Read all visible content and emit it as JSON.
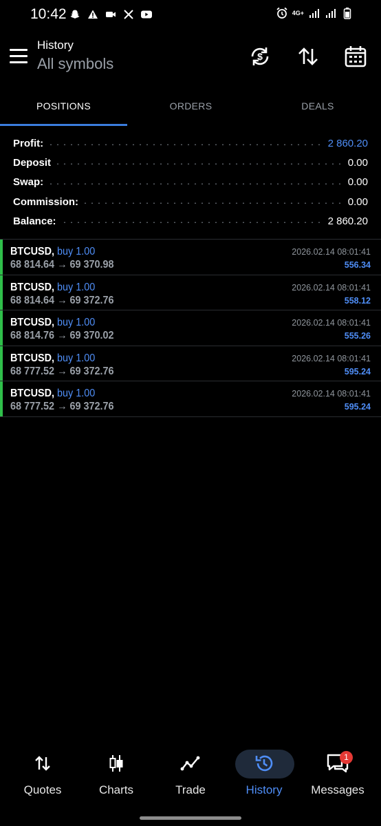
{
  "status_bar": {
    "time": "10:42",
    "network": "4G+"
  },
  "header": {
    "title": "History",
    "subtitle": "All symbols"
  },
  "tabs": [
    {
      "label": "POSITIONS",
      "active": true
    },
    {
      "label": "ORDERS",
      "active": false
    },
    {
      "label": "DEALS",
      "active": false
    }
  ],
  "summary": [
    {
      "label": "Profit:",
      "value": "2 860.20"
    },
    {
      "label": "Deposit",
      "value": "0.00"
    },
    {
      "label": "Swap:",
      "value": "0.00"
    },
    {
      "label": "Commission:",
      "value": "0.00"
    },
    {
      "label": "Balance:",
      "value": "2 860.20"
    }
  ],
  "positions": [
    {
      "symbol": "BTCUSD,",
      "type": "buy 1.00",
      "prices": "68 814.64 → 69 370.98",
      "time": "2026.02.14 08:01:41",
      "profit": "556.34"
    },
    {
      "symbol": "BTCUSD,",
      "type": "buy 1.00",
      "prices": "68 814.64 → 69 372.76",
      "time": "2026.02.14 08:01:41",
      "profit": "558.12"
    },
    {
      "symbol": "BTCUSD,",
      "type": "buy 1.00",
      "prices": "68 814.76 → 69 370.02",
      "time": "2026.02.14 08:01:41",
      "profit": "555.26"
    },
    {
      "symbol": "BTCUSD,",
      "type": "buy 1.00",
      "prices": "68 777.52 → 69 372.76",
      "time": "2026.02.14 08:01:41",
      "profit": "595.24"
    },
    {
      "symbol": "BTCUSD,",
      "type": "buy 1.00",
      "prices": "68 777.52 → 69 372.76",
      "time": "2026.02.14 08:01:41",
      "profit": "595.24"
    }
  ],
  "nav": [
    {
      "label": "Quotes",
      "icon": "quotes-icon"
    },
    {
      "label": "Charts",
      "icon": "charts-icon"
    },
    {
      "label": "Trade",
      "icon": "trade-icon"
    },
    {
      "label": "History",
      "icon": "history-icon",
      "active": true
    },
    {
      "label": "Messages",
      "icon": "messages-icon"
    }
  ],
  "messages_badge": "1",
  "colors": {
    "accent": "#4f8ef7",
    "buy_bar": "#2fbf4a",
    "background": "#000000"
  }
}
